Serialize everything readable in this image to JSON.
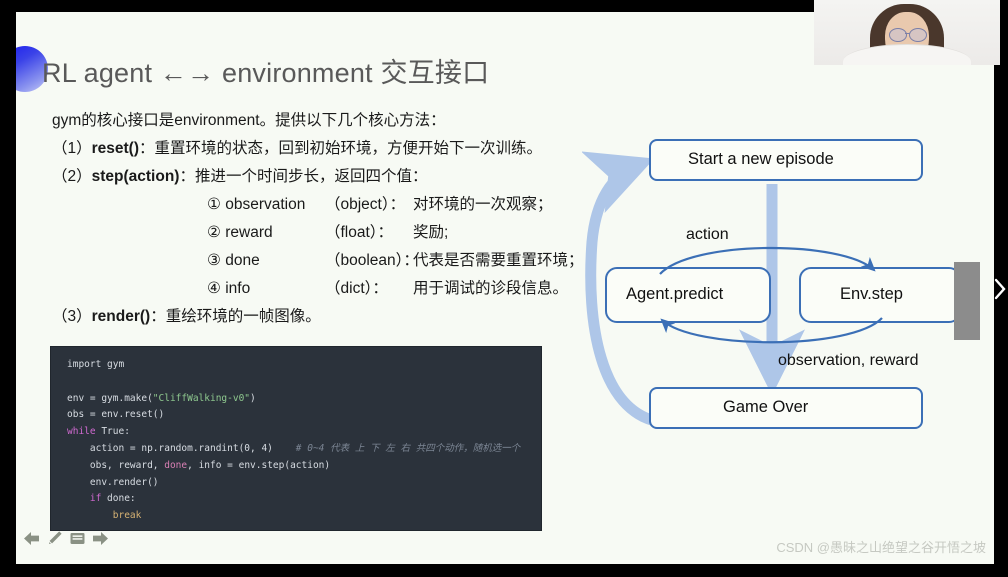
{
  "slide": {
    "title": "RL agent ←→ environment 交互接口",
    "intro": "gym的核心接口是environment。提供以下几个核心方法：",
    "methods": [
      {
        "num": "（1）",
        "name": "reset()",
        "sep": "：",
        "desc": "重置环境的状态，回到初始环境，方便开始下一次训练。"
      },
      {
        "num": "（2）",
        "name": "step(action)",
        "sep": "：",
        "desc": "推进一个时间步长，返回四个值："
      },
      {
        "num": "（3）",
        "name": "render()",
        "sep": "：",
        "desc": "重绘环境的一帧图像。"
      }
    ],
    "returns": [
      {
        "mark": "①",
        "name": "observation",
        "type": "（object）：",
        "desc": "对环境的一次观察；"
      },
      {
        "mark": "②",
        "name": "reward",
        "type": "（float）：",
        "desc": "奖励;"
      },
      {
        "mark": "③",
        "name": "done",
        "type": "（boolean）：",
        "desc": "代表是否需要重置环境；"
      },
      {
        "mark": "④",
        "name": "info",
        "type": "（dict）：",
        "desc": "用于调试的诊段信息。"
      }
    ]
  },
  "code": {
    "lines": [
      {
        "indent": 0,
        "tokens": [
          {
            "t": "import gym",
            "c": "plain"
          }
        ]
      },
      {
        "indent": 0,
        "tokens": [
          {
            "t": "",
            "c": "plain"
          }
        ]
      },
      {
        "indent": 0,
        "tokens": [
          {
            "t": "env = gym.make(",
            "c": "plain"
          },
          {
            "t": "\"CliffWalking-v0\"",
            "c": "str"
          },
          {
            "t": ")",
            "c": "plain"
          }
        ]
      },
      {
        "indent": 0,
        "tokens": [
          {
            "t": "obs = env.reset()",
            "c": "plain"
          }
        ]
      },
      {
        "indent": 0,
        "tokens": [
          {
            "t": "while",
            "c": "kw"
          },
          {
            "t": " True:",
            "c": "plain"
          }
        ]
      },
      {
        "indent": 1,
        "tokens": [
          {
            "t": "action = np.random.randint(0, 4)",
            "c": "plain"
          },
          {
            "t": "    # 0~4 代表 上 下 左 右 共四个动作，随机选一个",
            "c": "cm"
          }
        ]
      },
      {
        "indent": 1,
        "tokens": [
          {
            "t": "obs, reward, ",
            "c": "plain"
          },
          {
            "t": "done",
            "c": "var"
          },
          {
            "t": ", info = env.step(action)",
            "c": "plain"
          }
        ]
      },
      {
        "indent": 1,
        "tokens": [
          {
            "t": "env.render()",
            "c": "plain"
          }
        ]
      },
      {
        "indent": 1,
        "tokens": [
          {
            "t": "if",
            "c": "kw"
          },
          {
            "t": " done:",
            "c": "plain"
          }
        ]
      },
      {
        "indent": 2,
        "tokens": [
          {
            "t": "break",
            "c": "brk"
          }
        ]
      }
    ]
  },
  "diagram": {
    "boxes": [
      {
        "id": "start",
        "label": "Start a new episode"
      },
      {
        "id": "agent",
        "label": "Agent.predict"
      },
      {
        "id": "env",
        "label": "Env.step"
      },
      {
        "id": "gameover",
        "label": "Game Over"
      }
    ],
    "edge_labels": [
      {
        "id": "action",
        "label": "action"
      },
      {
        "id": "obs-reward",
        "label": "observation, reward"
      }
    ],
    "colors": {
      "box_border": "#3b6fb6",
      "arrow_dark": "#3b6fb6",
      "arrow_light": "#aec6e8"
    }
  },
  "toolbar": {
    "items": [
      {
        "id": "prev",
        "label": "上一页",
        "icon": "arrow-left-icon"
      },
      {
        "id": "pen",
        "label": "画笔",
        "icon": "pen-icon"
      },
      {
        "id": "note",
        "label": "备注",
        "icon": "note-icon"
      },
      {
        "id": "next",
        "label": "下一页",
        "icon": "arrow-right-icon"
      }
    ]
  },
  "watermark": {
    "text": "CSDN @愚昧之山绝望之谷开悟之坡"
  },
  "edge_tab": {
    "icon": "chevron-right-icon",
    "label": "展开面板"
  },
  "webcam": {
    "label": "讲师摄像头画面"
  }
}
